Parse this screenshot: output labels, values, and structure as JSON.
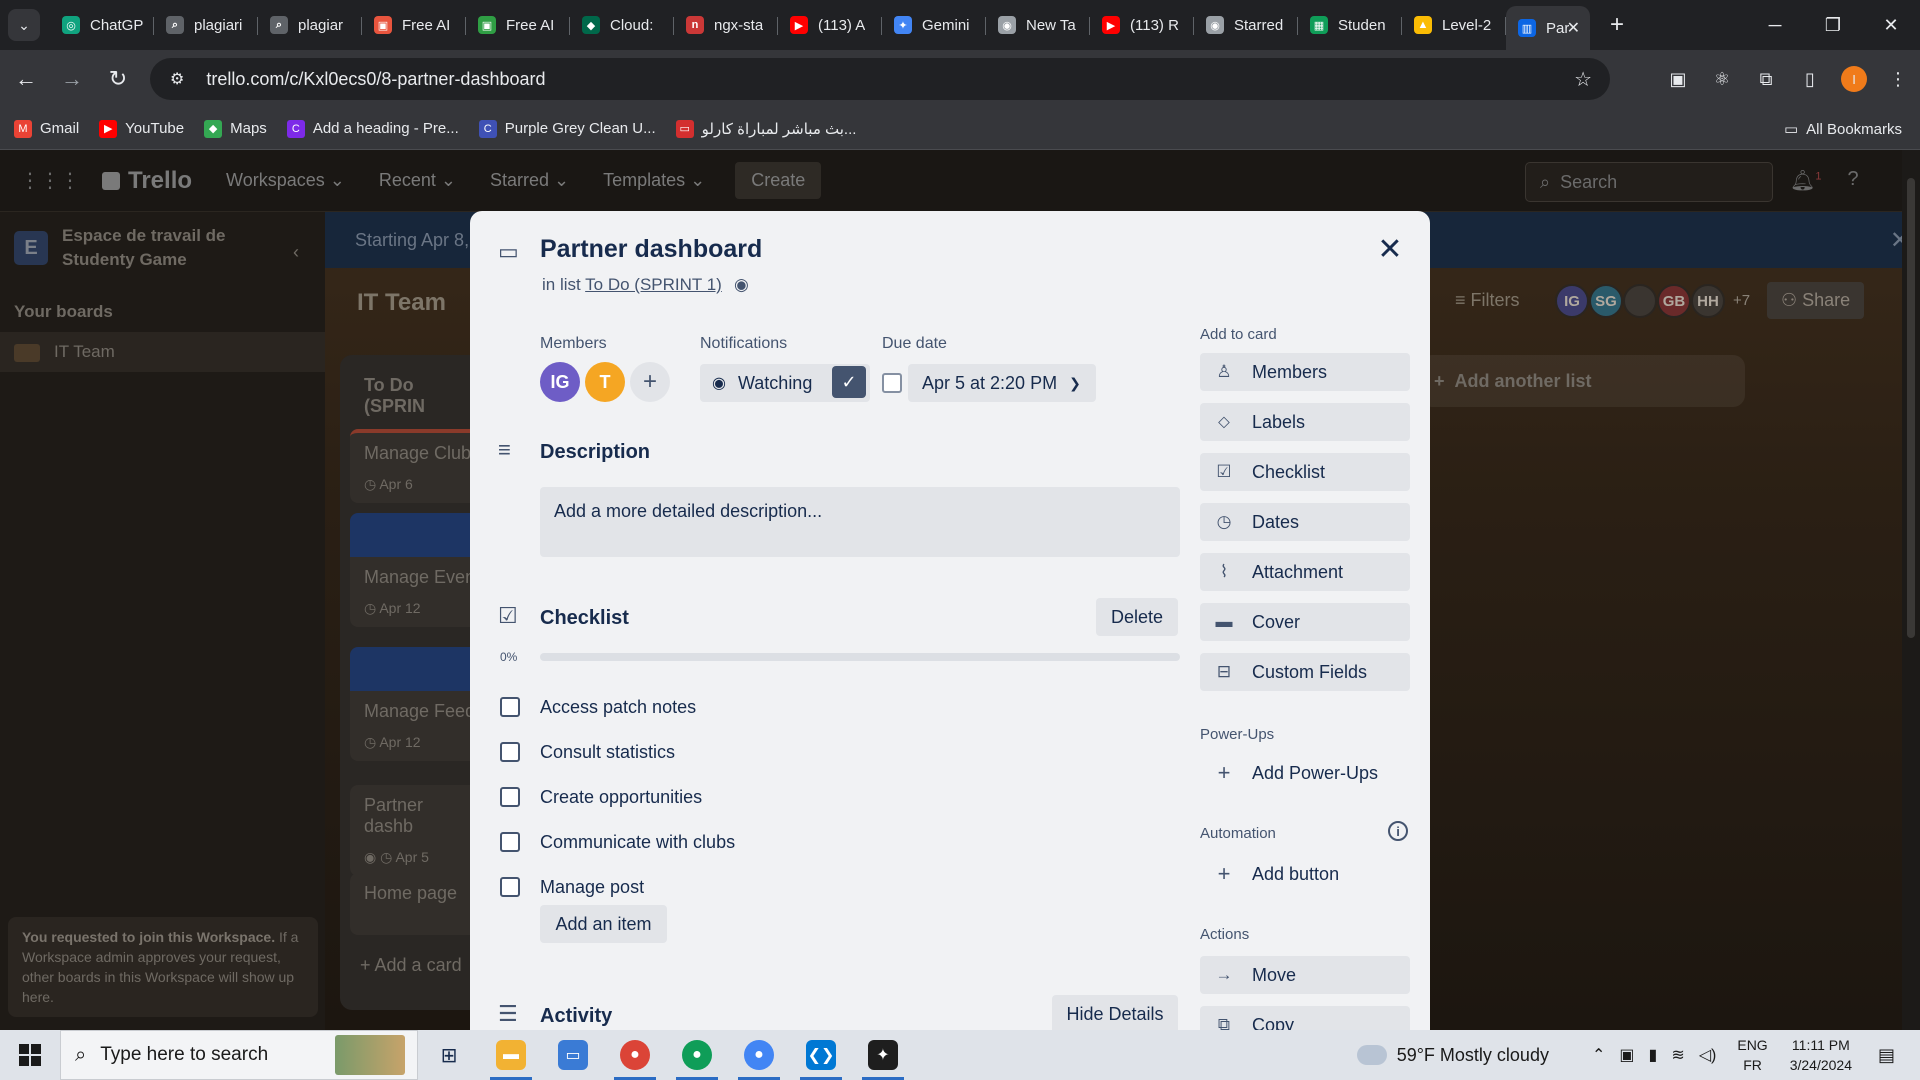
{
  "browser": {
    "tabs": [
      {
        "title": "ChatGP",
        "icon": "chatgpt-icon",
        "color": "#10a37f"
      },
      {
        "title": "plagiari",
        "icon": "search-icon",
        "color": "#5f6368"
      },
      {
        "title": "plagiar",
        "icon": "search-icon",
        "color": "#5f6368"
      },
      {
        "title": "Free AI",
        "icon": "free-ai-icon",
        "color": "#e8553e"
      },
      {
        "title": "Free AI",
        "icon": "free-ai-icon",
        "color": "#2f9e44"
      },
      {
        "title": "Cloud:",
        "icon": "mongodb-icon",
        "color": "#00684a"
      },
      {
        "title": "ngx-sta",
        "icon": "npm-icon",
        "color": "#cb3837"
      },
      {
        "title": "(113) A",
        "icon": "youtube-icon",
        "color": "#ff0000"
      },
      {
        "title": "Gemini",
        "icon": "gemini-icon",
        "color": "#4285f4"
      },
      {
        "title": "New Ta",
        "icon": "chrome-icon",
        "color": "#9aa0a6"
      },
      {
        "title": "(113) R",
        "icon": "youtube-icon",
        "color": "#ff0000"
      },
      {
        "title": "Starred",
        "icon": "github-icon",
        "color": "#9aa0a6"
      },
      {
        "title": "Studen",
        "icon": "sheets-icon",
        "color": "#0f9d58"
      },
      {
        "title": "Level-2",
        "icon": "drive-icon",
        "color": "#fbbc04"
      }
    ],
    "active_tab": {
      "title": "Par",
      "icon": "trello-icon",
      "color": "#0c66e4"
    },
    "url_site_icon": "site-settings-icon",
    "url": "trello.com/c/Kxl0ecs0/8-partner-dashboard",
    "profile_initial": "I",
    "bookmarks": [
      {
        "label": "Gmail",
        "icon": "gmail-icon",
        "color": "#ea4335"
      },
      {
        "label": "YouTube",
        "icon": "youtube-icon",
        "color": "#ff0000"
      },
      {
        "label": "Maps",
        "icon": "maps-icon",
        "color": "#34a853"
      },
      {
        "label": "Add a heading - Pre...",
        "icon": "canva-icon",
        "color": "#7d2ae8"
      },
      {
        "label": "Purple Grey Clean U...",
        "icon": "canva-icon",
        "color": "#3f51b5"
      },
      {
        "label": "بث مباشر لمباراة كارلو...",
        "icon": "tv-icon",
        "color": "#d32f2f"
      }
    ],
    "all_bookmarks": "All Bookmarks"
  },
  "trello": {
    "logo": "Trello",
    "menus": [
      "Workspaces",
      "Recent",
      "Starred",
      "Templates"
    ],
    "create": "Create",
    "search_placeholder": "Search",
    "notif_count": "1",
    "workspace_initial": "E",
    "workspace_name": "Espace de travail de Studenty Game",
    "your_boards": "Your boards",
    "board_item": "IT Team",
    "join_notice_bold": "You requested to join this Workspace.",
    "join_notice": " If a Workspace admin approves your request, other boards in this Workspace will show up here.",
    "banner": "Starting Apr 8,",
    "board_name": "IT Team",
    "filters": "Filters",
    "board_members": [
      "IG",
      "SG",
      "",
      "GB",
      "HH"
    ],
    "extra_members": "+7",
    "share": "Share",
    "add_list": "Add another list",
    "list_title": "To Do (SPRIN",
    "cards": [
      {
        "title": "Manage Club",
        "date": "Apr 6"
      },
      {
        "title": "Manage Even",
        "date": "Apr 12"
      },
      {
        "title": "Manage Feed",
        "date": "Apr 12"
      },
      {
        "title": "Partner dashb",
        "date": "Apr 5"
      },
      {
        "title": "Home page",
        "date": ""
      }
    ],
    "add_card": "Add a card"
  },
  "card": {
    "title": "Partner dashboard",
    "in_list_prefix": "in list",
    "list_name": "To Do (SPRINT 1)",
    "members_label": "Members",
    "members": [
      {
        "initials": "IG",
        "color": "#6e5dc6"
      },
      {
        "initials": "T",
        "color": "#f5a623"
      }
    ],
    "notifications_label": "Notifications",
    "watching": "Watching",
    "due_label": "Due date",
    "due_value": "Apr 5 at 2:20 PM",
    "description_title": "Description",
    "description_placeholder": "Add a more detailed description...",
    "checklist_title": "Checklist",
    "delete": "Delete",
    "progress": "0%",
    "progress_value": 0,
    "items": [
      "Access patch notes",
      "Consult statistics",
      "Create opportunities",
      "Communicate with clubs",
      "Manage post"
    ],
    "add_item": "Add an item",
    "activity_title": "Activity",
    "hide_details": "Hide Details",
    "add_to_card": "Add to card",
    "add_buttons": [
      {
        "label": "Members",
        "icon": "person-icon"
      },
      {
        "label": "Labels",
        "icon": "tag-icon"
      },
      {
        "label": "Checklist",
        "icon": "checklist-icon"
      },
      {
        "label": "Dates",
        "icon": "clock-icon"
      },
      {
        "label": "Attachment",
        "icon": "paperclip-icon"
      },
      {
        "label": "Cover",
        "icon": "cover-icon"
      },
      {
        "label": "Custom Fields",
        "icon": "custom-fields-icon"
      }
    ],
    "powerups_label": "Power-Ups",
    "add_powerups": "Add Power-Ups",
    "automation_label": "Automation",
    "add_button": "Add button",
    "actions_label": "Actions",
    "move": "Move",
    "copy": "Copy"
  },
  "taskbar": {
    "search_placeholder": "Type here to search",
    "weather": "59°F  Mostly cloudy",
    "lang1": "ENG",
    "lang2": "FR",
    "time": "11:11 PM",
    "date": "3/24/2024"
  }
}
